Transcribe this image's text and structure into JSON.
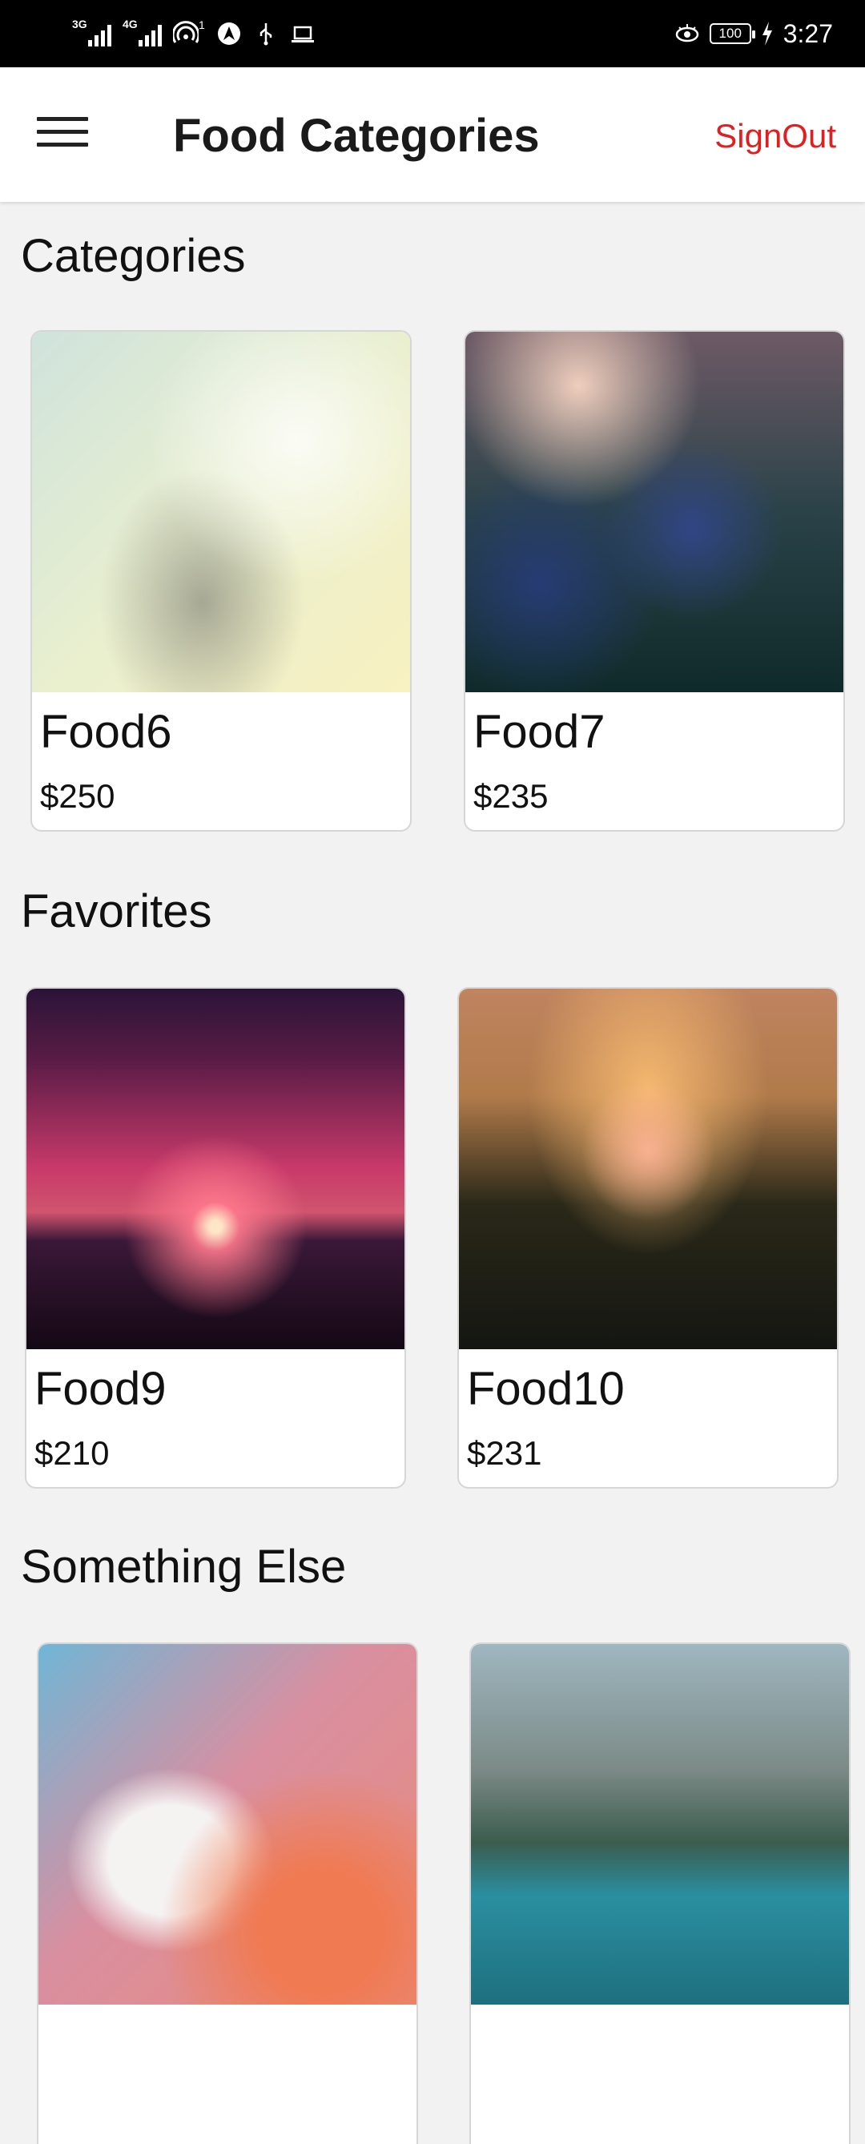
{
  "status_bar": {
    "signal1_label": "3G",
    "signal2_label": "4G",
    "hotspot_badge": "1",
    "battery": "100",
    "time": "3:27"
  },
  "app_bar": {
    "title": "Food Categories",
    "signout_label": "SignOut"
  },
  "sections": [
    {
      "title": "Categories",
      "items": [
        {
          "name": "Food6",
          "price": "$250"
        },
        {
          "name": "Food7",
          "price": "$235"
        }
      ]
    },
    {
      "title": "Favorites",
      "items": [
        {
          "name": "Food9",
          "price": "$210"
        },
        {
          "name": "Food10",
          "price": "$231"
        }
      ]
    },
    {
      "title": "Something Else",
      "items": [
        {
          "name": "",
          "price": ""
        },
        {
          "name": "",
          "price": ""
        }
      ]
    }
  ],
  "colors": {
    "accent": "#e02020",
    "background": "#f2f2f2",
    "status_bar": "#000000"
  }
}
